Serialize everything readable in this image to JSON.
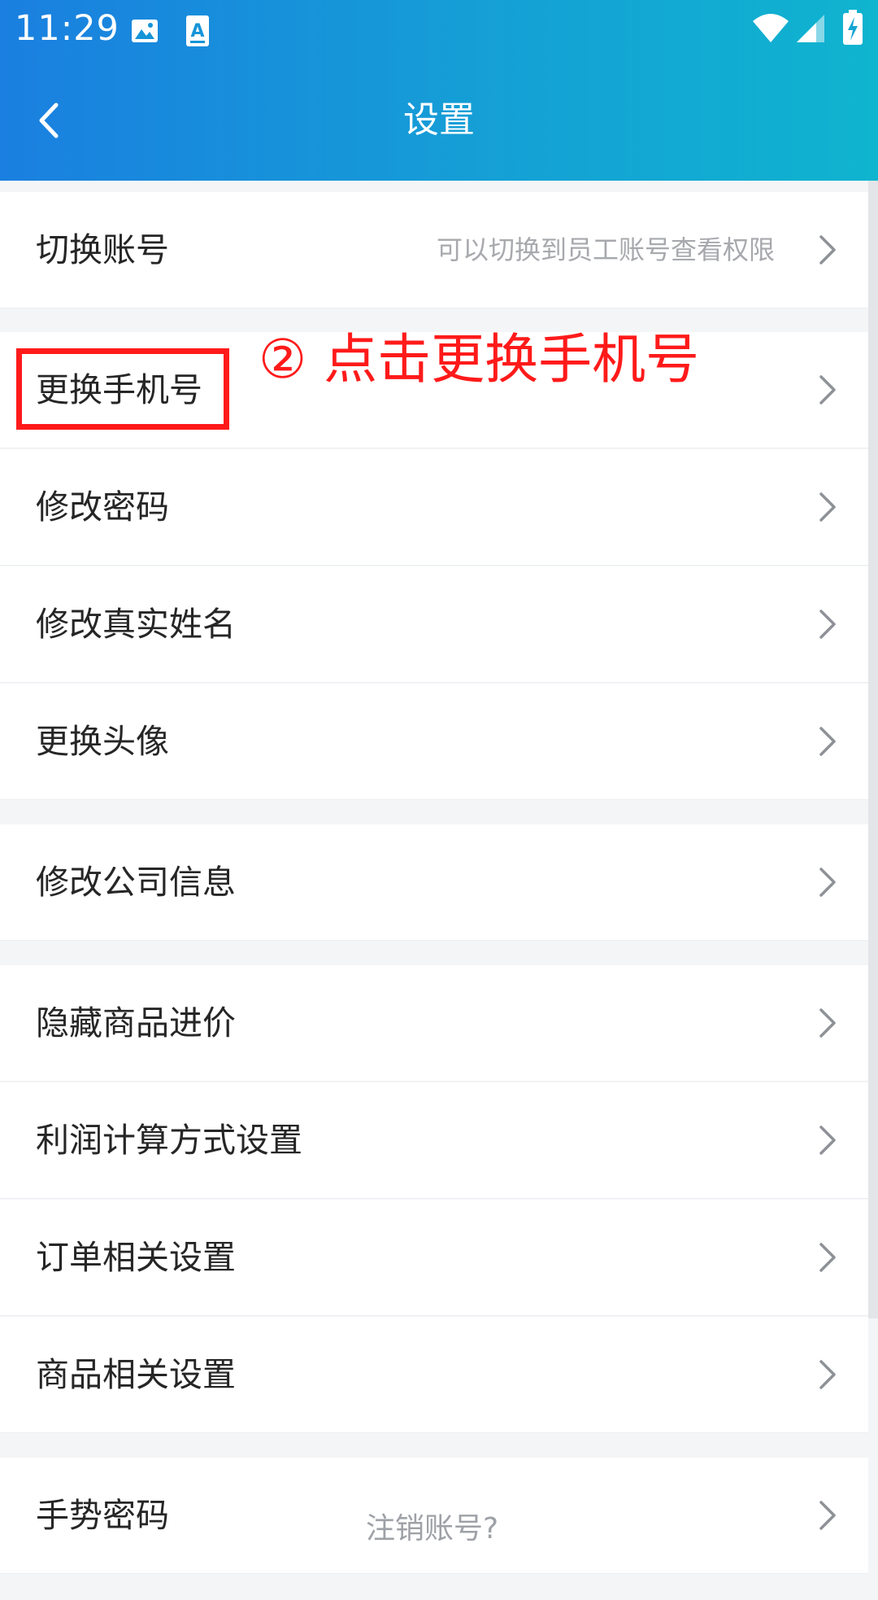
{
  "status_bar": {
    "time": "11:29",
    "icons": [
      "image-icon",
      "a-icon",
      "wifi-icon",
      "signal-icon",
      "battery-charging-icon"
    ]
  },
  "app_bar": {
    "title": "设置",
    "back_icon": "chevron-left-icon"
  },
  "settings": {
    "items": [
      {
        "label": "切换账号",
        "hint": "可以切换到员工账号查看权限"
      },
      {
        "label": "更换手机号"
      },
      {
        "label": "修改密码"
      },
      {
        "label": "修改真实姓名"
      },
      {
        "label": "更换头像"
      },
      {
        "label": "修改公司信息"
      },
      {
        "label": "隐藏商品进价"
      },
      {
        "label": "利润计算方式设置"
      },
      {
        "label": "订单相关设置"
      },
      {
        "label": "商品相关设置"
      },
      {
        "label": "手势密码"
      }
    ],
    "deregister_link": "注销账号?"
  },
  "annotation": {
    "text": "② 点击更换手机号"
  },
  "colors": {
    "header_start": "#1a7fe0",
    "header_end": "#0fb4cf",
    "annotation_red": "#ff1a1a",
    "background": "#f4f5f7"
  }
}
